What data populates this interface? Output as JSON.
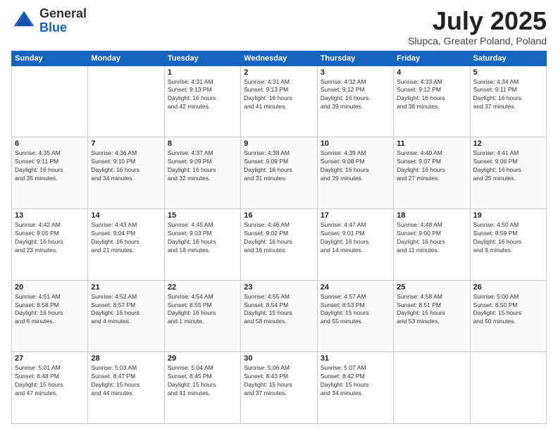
{
  "header": {
    "logo_general": "General",
    "logo_blue": "Blue",
    "month": "July 2025",
    "location": "Slupca, Greater Poland, Poland"
  },
  "days_of_week": [
    "Sunday",
    "Monday",
    "Tuesday",
    "Wednesday",
    "Thursday",
    "Friday",
    "Saturday"
  ],
  "weeks": [
    [
      {
        "day": "",
        "info": ""
      },
      {
        "day": "",
        "info": ""
      },
      {
        "day": "1",
        "info": "Sunrise: 4:31 AM\nSunset: 9:13 PM\nDaylight: 16 hours\nand 42 minutes."
      },
      {
        "day": "2",
        "info": "Sunrise: 4:31 AM\nSunset: 9:13 PM\nDaylight: 16 hours\nand 41 minutes."
      },
      {
        "day": "3",
        "info": "Sunrise: 4:32 AM\nSunset: 9:12 PM\nDaylight: 16 hours\nand 39 minutes."
      },
      {
        "day": "4",
        "info": "Sunrise: 4:33 AM\nSunset: 9:12 PM\nDaylight: 16 hours\nand 38 minutes."
      },
      {
        "day": "5",
        "info": "Sunrise: 4:34 AM\nSunset: 9:11 PM\nDaylight: 16 hours\nand 37 minutes."
      }
    ],
    [
      {
        "day": "6",
        "info": "Sunrise: 4:35 AM\nSunset: 9:11 PM\nDaylight: 16 hours\nand 35 minutes."
      },
      {
        "day": "7",
        "info": "Sunrise: 4:36 AM\nSunset: 9:10 PM\nDaylight: 16 hours\nand 34 minutes."
      },
      {
        "day": "8",
        "info": "Sunrise: 4:37 AM\nSunset: 9:09 PM\nDaylight: 16 hours\nand 32 minutes."
      },
      {
        "day": "9",
        "info": "Sunrise: 4:38 AM\nSunset: 9:09 PM\nDaylight: 16 hours\nand 31 minutes."
      },
      {
        "day": "10",
        "info": "Sunrise: 4:39 AM\nSunset: 9:08 PM\nDaylight: 16 hours\nand 29 minutes."
      },
      {
        "day": "11",
        "info": "Sunrise: 4:40 AM\nSunset: 9:07 PM\nDaylight: 16 hours\nand 27 minutes."
      },
      {
        "day": "12",
        "info": "Sunrise: 4:41 AM\nSunset: 9:06 PM\nDaylight: 16 hours\nand 25 minutes."
      }
    ],
    [
      {
        "day": "13",
        "info": "Sunrise: 4:42 AM\nSunset: 9:05 PM\nDaylight: 16 hours\nand 23 minutes."
      },
      {
        "day": "14",
        "info": "Sunrise: 4:43 AM\nSunset: 9:04 PM\nDaylight: 16 hours\nand 21 minutes."
      },
      {
        "day": "15",
        "info": "Sunrise: 4:45 AM\nSunset: 9:03 PM\nDaylight: 16 hours\nand 18 minutes."
      },
      {
        "day": "16",
        "info": "Sunrise: 4:46 AM\nSunset: 9:02 PM\nDaylight: 16 hours\nand 16 minutes."
      },
      {
        "day": "17",
        "info": "Sunrise: 4:47 AM\nSunset: 9:01 PM\nDaylight: 16 hours\nand 14 minutes."
      },
      {
        "day": "18",
        "info": "Sunrise: 4:48 AM\nSunset: 9:00 PM\nDaylight: 16 hours\nand 11 minutes."
      },
      {
        "day": "19",
        "info": "Sunrise: 4:50 AM\nSunset: 8:59 PM\nDaylight: 16 hours\nand 9 minutes."
      }
    ],
    [
      {
        "day": "20",
        "info": "Sunrise: 4:51 AM\nSunset: 8:58 PM\nDaylight: 16 hours\nand 6 minutes."
      },
      {
        "day": "21",
        "info": "Sunrise: 4:52 AM\nSunset: 8:57 PM\nDaylight: 16 hours\nand 4 minutes."
      },
      {
        "day": "22",
        "info": "Sunrise: 4:54 AM\nSunset: 8:55 PM\nDaylight: 16 hours\nand 1 minute."
      },
      {
        "day": "23",
        "info": "Sunrise: 4:55 AM\nSunset: 8:54 PM\nDaylight: 15 hours\nand 58 minutes."
      },
      {
        "day": "24",
        "info": "Sunrise: 4:57 AM\nSunset: 8:53 PM\nDaylight: 15 hours\nand 55 minutes."
      },
      {
        "day": "25",
        "info": "Sunrise: 4:58 AM\nSunset: 8:51 PM\nDaylight: 15 hours\nand 53 minutes."
      },
      {
        "day": "26",
        "info": "Sunrise: 5:00 AM\nSunset: 8:50 PM\nDaylight: 15 hours\nand 50 minutes."
      }
    ],
    [
      {
        "day": "27",
        "info": "Sunrise: 5:01 AM\nSunset: 8:48 PM\nDaylight: 15 hours\nand 47 minutes."
      },
      {
        "day": "28",
        "info": "Sunrise: 5:03 AM\nSunset: 8:47 PM\nDaylight: 15 hours\nand 44 minutes."
      },
      {
        "day": "29",
        "info": "Sunrise: 5:04 AM\nSunset: 8:45 PM\nDaylight: 15 hours\nand 41 minutes."
      },
      {
        "day": "30",
        "info": "Sunrise: 5:06 AM\nSunset: 8:43 PM\nDaylight: 15 hours\nand 37 minutes."
      },
      {
        "day": "31",
        "info": "Sunrise: 5:07 AM\nSunset: 8:42 PM\nDaylight: 15 hours\nand 34 minutes."
      },
      {
        "day": "",
        "info": ""
      },
      {
        "day": "",
        "info": ""
      }
    ]
  ]
}
